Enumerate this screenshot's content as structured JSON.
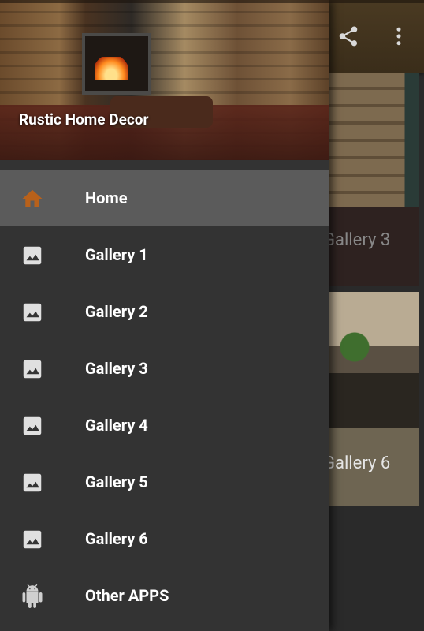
{
  "app": {
    "cards": [
      {
        "label": "Gallery 3"
      },
      {
        "label": "Gallery 6"
      }
    ],
    "actions": {
      "share_icon": "share-icon",
      "more_icon": "more-vert-icon"
    }
  },
  "drawer": {
    "title": "Rustic Home Decor",
    "items": [
      {
        "label": "Home",
        "icon": "home-icon",
        "active": true
      },
      {
        "label": "Gallery 1",
        "icon": "image-icon"
      },
      {
        "label": "Gallery 2",
        "icon": "image-icon"
      },
      {
        "label": "Gallery 3",
        "icon": "image-icon"
      },
      {
        "label": "Gallery 4",
        "icon": "image-icon"
      },
      {
        "label": "Gallery 5",
        "icon": "image-icon"
      },
      {
        "label": "Gallery 6",
        "icon": "image-icon"
      },
      {
        "label": "Other APPS",
        "icon": "android-icon"
      }
    ]
  },
  "colors": {
    "drawer_bg": "#333333",
    "active_item_bg": "#5b5b5b",
    "home_icon": "#b8611b",
    "image_icon": "#e0e0e0",
    "android_icon": "#cfcfcf"
  }
}
